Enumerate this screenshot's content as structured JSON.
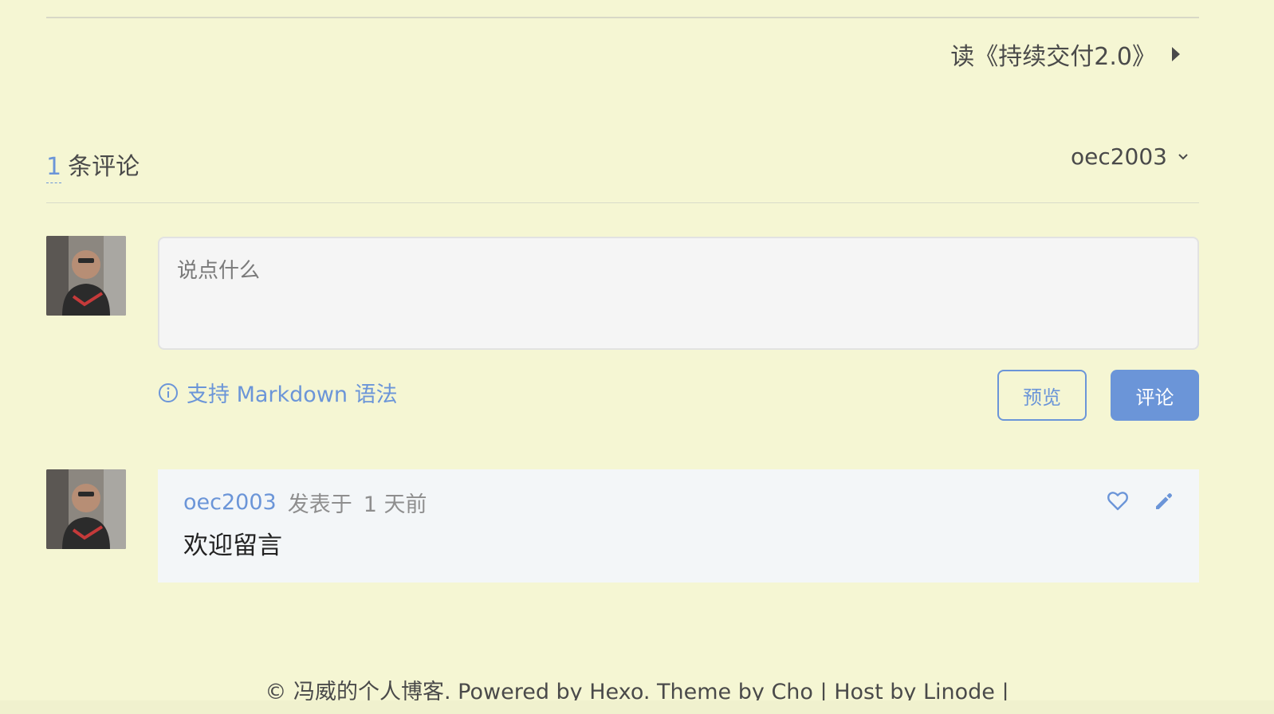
{
  "navigation": {
    "next_post": "读《持续交付2.0》"
  },
  "comments_section": {
    "count": "1",
    "count_label": "条评论",
    "user_menu": "oec2003"
  },
  "composer": {
    "placeholder": "说点什么",
    "markdown_hint": "支持 Markdown 语法",
    "preview_button": "预览",
    "submit_button": "评论"
  },
  "comments": [
    {
      "author": "oec2003",
      "posted_prefix": "发表于",
      "posted_time": "1 天前",
      "body": "欢迎留言"
    }
  ],
  "footer": {
    "text": "© 冯威的个人博客. Powered by Hexo. Theme by Cho | Host by Linode |"
  },
  "colors": {
    "background": "#f5f6d3",
    "accent": "#6b95d8",
    "text": "#4a4a4a",
    "comment_card": "#f3f6f8",
    "textarea": "#f5f5f5"
  },
  "icons": {
    "next_arrow": "triangle-right-icon",
    "user_menu": "chevron-down-icon",
    "markdown_hint": "info-icon",
    "like": "heart-icon",
    "edit": "pencil-icon"
  }
}
